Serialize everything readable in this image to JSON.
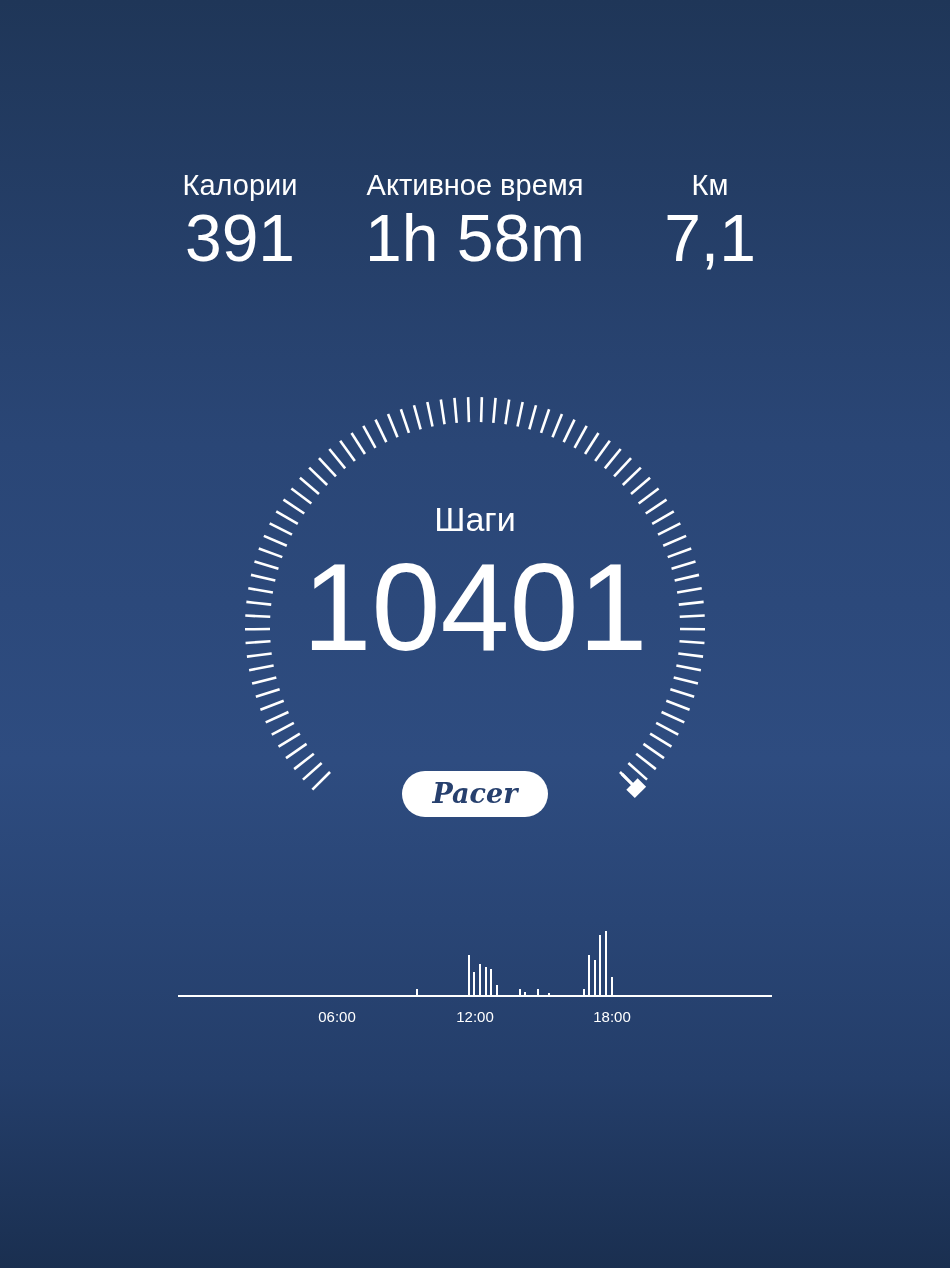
{
  "stats": [
    {
      "label": "Калории",
      "value": "391"
    },
    {
      "label": "Активное время",
      "value": "1h 58m"
    },
    {
      "label": "Км",
      "value": "7,1"
    }
  ],
  "gauge": {
    "label": "Шаги",
    "value": "10401"
  },
  "logo": "Pacer",
  "activity": {
    "kind": "picture",
    "axis_labels": [
      "06:00",
      "12:00",
      "18:00"
    ]
  }
}
